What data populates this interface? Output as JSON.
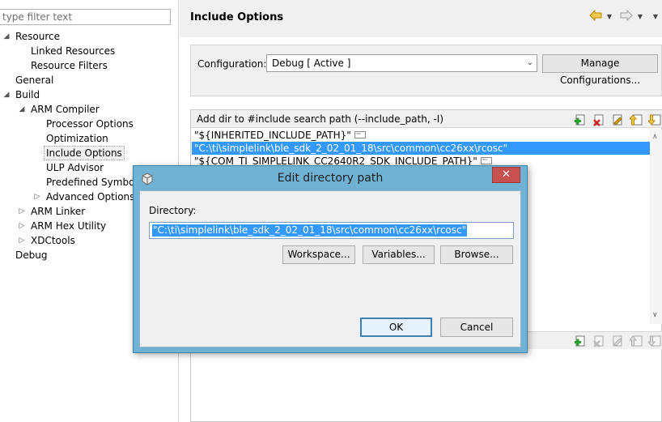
{
  "left_panel": {
    "filter_placeholder": "type filter text",
    "tree": [
      {
        "label": "Resource",
        "toggle": "◢"
      },
      {
        "label": "Linked Resources",
        "toggle": ""
      },
      {
        "label": "Resource Filters",
        "toggle": ""
      },
      {
        "label": "General",
        "toggle": ""
      },
      {
        "label": "Build",
        "toggle": "◢"
      },
      {
        "label": "ARM Compiler",
        "toggle": "◢"
      },
      {
        "label": "Processor Options",
        "toggle": ""
      },
      {
        "label": "Optimization",
        "toggle": ""
      },
      {
        "label": "Include Options",
        "toggle": ""
      },
      {
        "label": "ULP Advisor",
        "toggle": ""
      },
      {
        "label": "Predefined Symbols",
        "toggle": ""
      },
      {
        "label": "Advanced Options",
        "toggle": "▷"
      },
      {
        "label": "ARM Linker",
        "toggle": "▷"
      },
      {
        "label": "ARM Hex Utility",
        "toggle": "▷"
      },
      {
        "label": "XDCtools",
        "toggle": "▷"
      },
      {
        "label": "Debug",
        "toggle": ""
      }
    ]
  },
  "header": {
    "title": "Include Options",
    "back_icon": "back-arrow-icon",
    "forward_icon": "forward-arrow-icon",
    "back_color": "#e8a317"
  },
  "configuration": {
    "label": "Configuration:",
    "selected": "Debug  [ Active ]",
    "manage_button": "Manage Configurations..."
  },
  "include_paths": {
    "title": "Add dir to #include search path (--include_path, -I)",
    "items": [
      "\"${INHERITED_INCLUDE_PATH}\"",
      "\"C:\\ti\\simplelink\\ble_sdk_2_02_01_18\\src\\common\\cc26xx\\rcosc\"",
      "\"${COM_TI_SIMPLELINK_CC2640R2_SDK_INCLUDE_PATH}\""
    ],
    "selected_index": 1
  },
  "dialog": {
    "title": "Edit directory path",
    "close_label": "✕",
    "directory_label": "Directory:",
    "directory_value": "\"C:\\ti\\simplelink\\ble_sdk_2_02_01_18\\src\\common\\cc26xx\\rcosc\"",
    "workspace_button": "Workspace...",
    "variables_button": "Variables...",
    "browse_button": "Browse...",
    "ok_button": "OK",
    "cancel_button": "Cancel",
    "titlebar_color": "#6fb2d3",
    "close_color": "#c75050"
  }
}
